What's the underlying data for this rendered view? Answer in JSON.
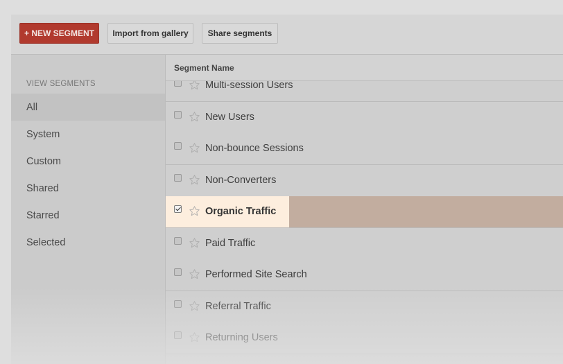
{
  "toolbar": {
    "new_segment_label": "+ NEW SEGMENT",
    "import_label": "Import from gallery",
    "share_label": "Share segments"
  },
  "sidebar": {
    "title": "VIEW SEGMENTS",
    "items": [
      {
        "label": "All",
        "active": true
      },
      {
        "label": "System",
        "active": false
      },
      {
        "label": "Custom",
        "active": false
      },
      {
        "label": "Shared",
        "active": false
      },
      {
        "label": "Starred",
        "active": false
      },
      {
        "label": "Selected",
        "active": false
      }
    ]
  },
  "table": {
    "column_header": "Segment Name",
    "rows": [
      {
        "label": "Multi-session Users",
        "checked": false
      },
      {
        "label": "New Users",
        "checked": false
      },
      {
        "label": "Non-bounce Sessions",
        "checked": false
      },
      {
        "label": "Non-Converters",
        "checked": false
      },
      {
        "label": "Organic Traffic",
        "checked": true
      },
      {
        "label": "Paid Traffic",
        "checked": false
      },
      {
        "label": "Performed Site Search",
        "checked": false
      },
      {
        "label": "Referral Traffic",
        "checked": false
      },
      {
        "label": "Returning Users",
        "checked": false
      }
    ]
  },
  "icons": {
    "star": "star-outline-icon",
    "checkbox": "checkbox-icon"
  },
  "colors": {
    "primary_button": "#b13a2e",
    "selected_row": "#c2ad9f",
    "selected_highlight": "#fdeede"
  }
}
